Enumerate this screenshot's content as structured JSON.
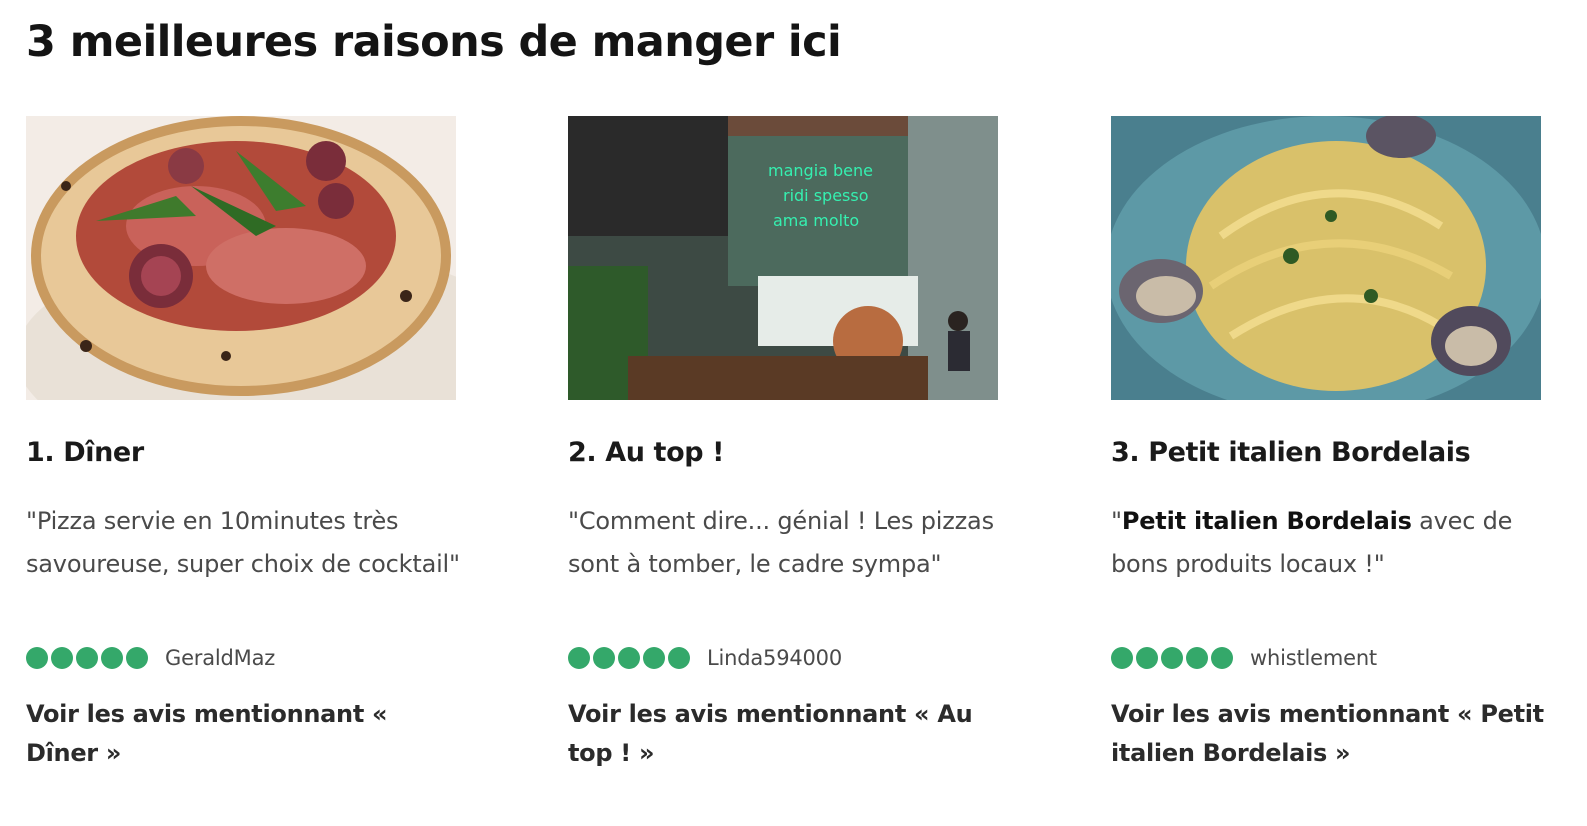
{
  "heading": "3 meilleures raisons de manger ici",
  "cards": [
    {
      "title": "1. Dîner",
      "quote_before": "\"Pizza servie en 10minutes très savoureuse, super choix de cocktail\"",
      "quote_bold": "",
      "quote_after": "",
      "rating": 5,
      "username": "GeraldMaz",
      "link": "Voir les avis mentionnant « Dîner »",
      "photo": "pizza-photo"
    },
    {
      "title": "2. Au top !",
      "quote_before": "\"Comment dire... génial ! Les pizzas sont à tomber, le cadre sympa\"",
      "quote_bold": "",
      "quote_after": "",
      "rating": 5,
      "username": "Linda594000",
      "link": "Voir les avis mentionnant « Au top ! »",
      "photo": "restaurant-interior-photo"
    },
    {
      "title": "3. Petit italien Bordelais",
      "quote_before": "\"",
      "quote_bold": "Petit italien Bordelais",
      "quote_after": " avec de bons produits locaux !\"",
      "rating": 5,
      "username": "whistlement",
      "link": "Voir les avis mentionnant « Petit italien Bordelais  »",
      "photo": "pasta-clams-photo"
    }
  ],
  "colors": {
    "rating_bubble": "#34a86a",
    "text_dark": "#1a1a1a",
    "text_muted": "#4a4a4a"
  }
}
